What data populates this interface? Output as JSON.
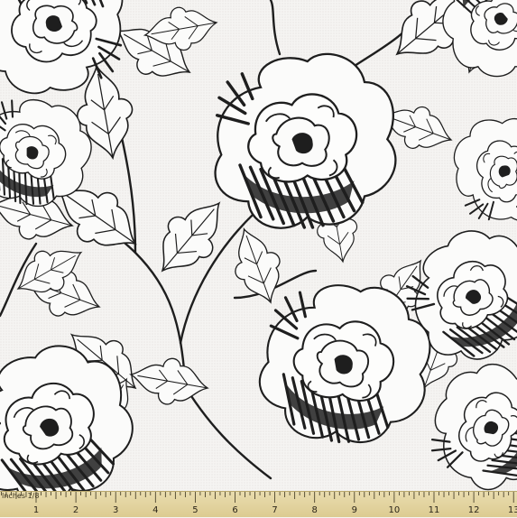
{
  "ruler": {
    "units_label": "Inches 1/8",
    "numbers": [
      "1",
      "2",
      "3",
      "4",
      "5",
      "6",
      "7",
      "8",
      "9",
      "10",
      "11",
      "12",
      "13"
    ]
  },
  "colors": {
    "fabric_bg": "#f5f4f2",
    "ink": "#1e1e1e",
    "ruler": "#e3d49e"
  }
}
